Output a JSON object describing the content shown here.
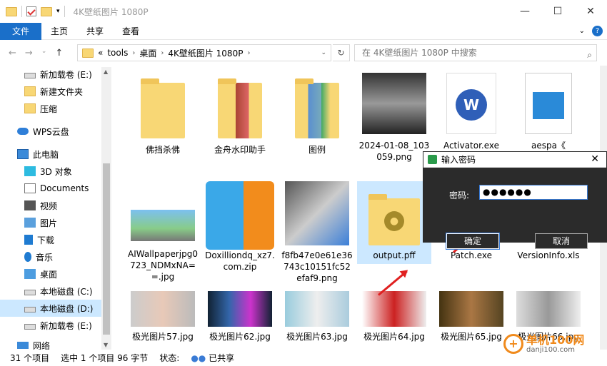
{
  "window": {
    "title": "4K壁纸图片 1080P",
    "controls": [
      "—",
      "☐",
      "✕"
    ]
  },
  "ribbon": {
    "tabs": [
      "文件",
      "主页",
      "共享",
      "查看"
    ]
  },
  "address": {
    "prefix": "«",
    "crumbs": [
      "tools",
      "桌面",
      "4K壁纸图片 1080P"
    ],
    "search_placeholder": "在 4K壁纸图片 1080P 中搜索"
  },
  "sidebar": {
    "items": [
      {
        "label": "新加载卷 (E:)",
        "icon": "drive-icon"
      },
      {
        "label": "新建文件夹",
        "icon": "folder-icon"
      },
      {
        "label": "压缩",
        "icon": "folder-icon"
      },
      {
        "label": "WPS云盘",
        "icon": "cloud-icon"
      },
      {
        "label": "此电脑",
        "icon": "pc-icon"
      },
      {
        "label": "3D 对象",
        "icon": "cube-icon"
      },
      {
        "label": "Documents",
        "icon": "document-icon"
      },
      {
        "label": "视频",
        "icon": "video-icon"
      },
      {
        "label": "图片",
        "icon": "picture-icon"
      },
      {
        "label": "下载",
        "icon": "download-icon"
      },
      {
        "label": "音乐",
        "icon": "music-icon"
      },
      {
        "label": "桌面",
        "icon": "desktop-icon"
      },
      {
        "label": "本地磁盘 (C:)",
        "icon": "drive-icon"
      },
      {
        "label": "本地磁盘 (D:)",
        "icon": "drive-icon"
      },
      {
        "label": "新加载卷 (E:)",
        "icon": "drive-icon"
      },
      {
        "label": "网络",
        "icon": "network-icon"
      }
    ]
  },
  "files": [
    {
      "name": "佛挡杀佛"
    },
    {
      "name": "金舟水印助手"
    },
    {
      "name": "图例"
    },
    {
      "name": "2024-01-08_103059.png"
    },
    {
      "name": "Activator.exe"
    },
    {
      "name": "aespa《"
    },
    {
      "name": "AIWallpaperjpg0723_NDMxNA==.jpg"
    },
    {
      "name": "Doxilliondq_xz7.com.zip"
    },
    {
      "name": "f8fb47e0e61e36743c10151fc52efaf9.png"
    },
    {
      "name": "output.pff"
    },
    {
      "name": "Patch.exe"
    },
    {
      "name": "VersionInfo.xls"
    },
    {
      "name": "极光图片57.jpg"
    },
    {
      "name": "极光图片62.jpg"
    },
    {
      "name": "极光图片63.jpg"
    },
    {
      "name": "极光图片64.jpg"
    },
    {
      "name": "极光图片65.jpg"
    },
    {
      "name": "极光图片66.jpg"
    }
  ],
  "dialog": {
    "title": "输入密码",
    "label": "密码:",
    "value": "●●●●●●",
    "ok": "确定",
    "cancel": "取消"
  },
  "status": {
    "count": "31 个项目",
    "selected": "选中 1 个项目  96 字节",
    "state": "状态:",
    "shared": "已共享"
  },
  "watermark": {
    "text": "单机100网",
    "sub": "danji100.com"
  },
  "colors": {
    "accent": "#1a6fc9",
    "selection": "#cce8ff",
    "arrow": "#e02020",
    "watermark": "#f08a1c"
  }
}
